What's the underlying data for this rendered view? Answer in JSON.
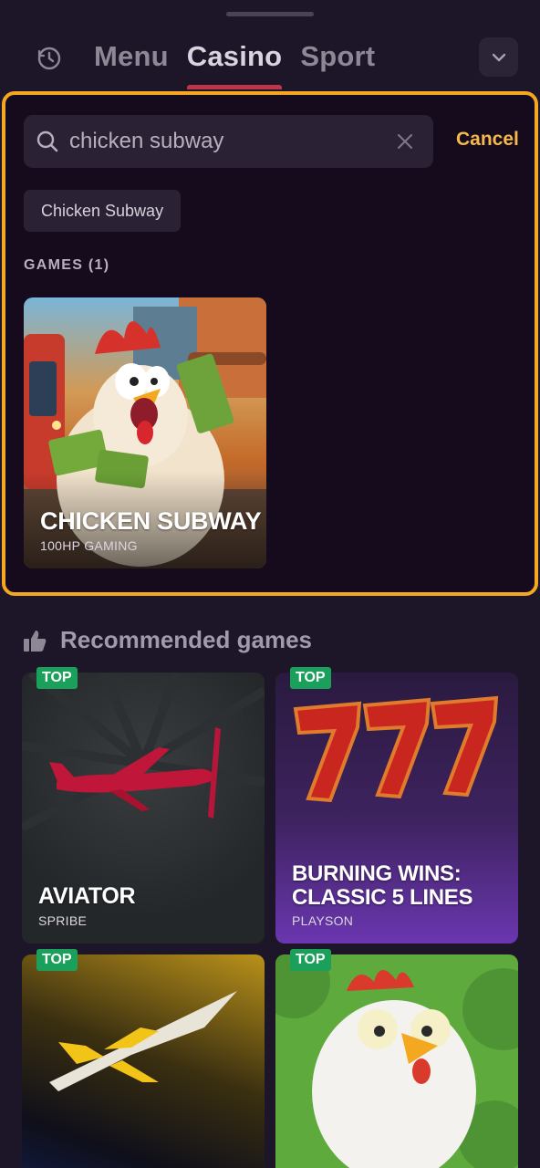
{
  "header": {
    "tabs": [
      {
        "label": "Menu",
        "active": false
      },
      {
        "label": "Casino",
        "active": true
      },
      {
        "label": "Sport",
        "active": false
      }
    ]
  },
  "search": {
    "value": "chicken subway",
    "cancel_label": "Cancel",
    "suggestion_chip": "Chicken Subway",
    "results_label": "GAMES (1)",
    "results": [
      {
        "title": "CHICKEN SUBWAY",
        "provider": "100HP GAMING"
      }
    ]
  },
  "recommended": {
    "title": "Recommended games",
    "games": [
      {
        "badge": "TOP",
        "title": "AVIATOR",
        "provider": "SPRIBE"
      },
      {
        "badge": "TOP",
        "title_line1": "BURNING WINS:",
        "title_line2": "CLASSIC 5 LINES",
        "provider": "PLAYSON"
      },
      {
        "badge": "TOP"
      },
      {
        "badge": "TOP"
      }
    ]
  },
  "colors": {
    "highlight_border": "#f5a623",
    "accent_cancel": "#f5b84a",
    "badge_green": "#1aa05a",
    "tab_underline": "#c0344a"
  }
}
